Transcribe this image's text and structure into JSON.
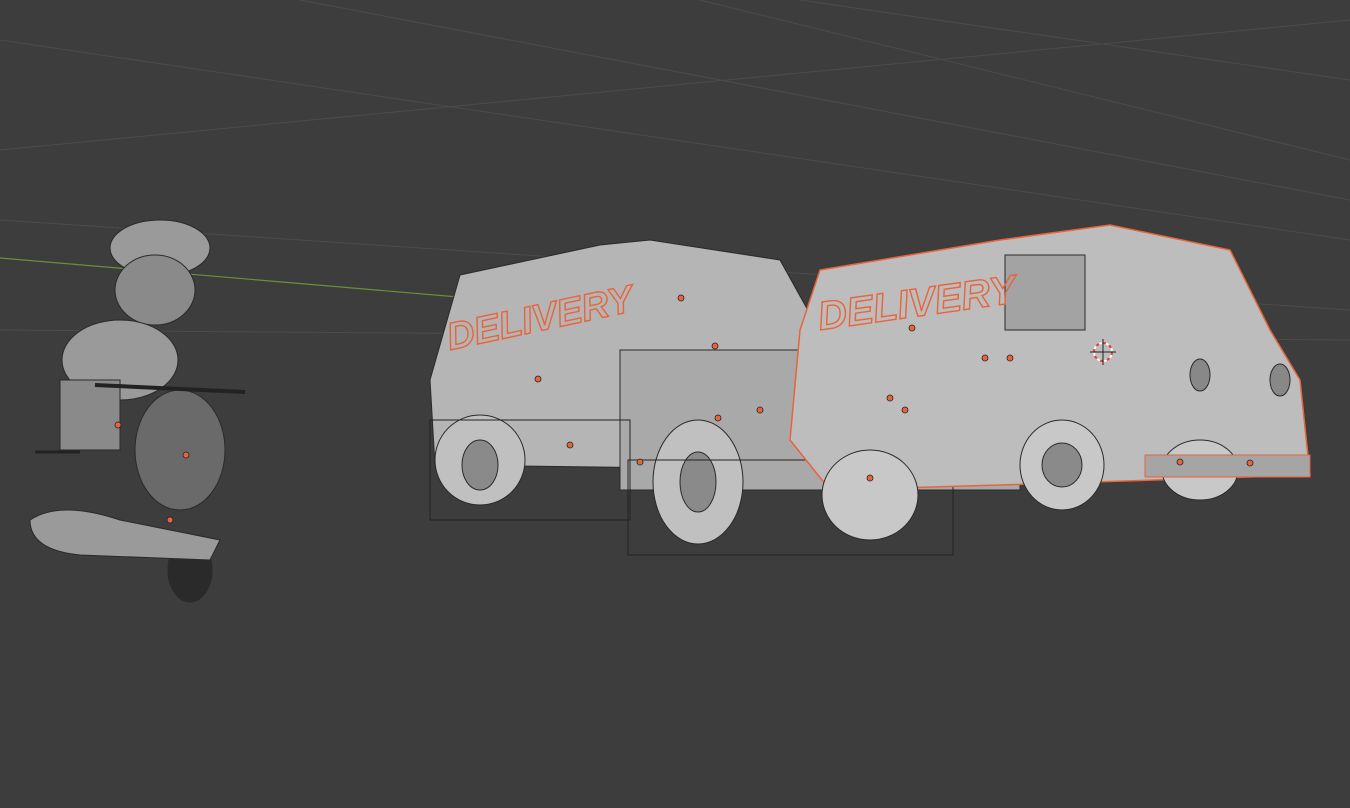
{
  "viewport": {
    "mode": "3D viewport - edit/wireframe overlay",
    "objects": [
      {
        "name": "scooter-rider"
      },
      {
        "name": "delivery-van-back",
        "decal": "DELIVERY"
      },
      {
        "name": "delivery-van-front",
        "decal": "DELIVERY",
        "selected": true
      }
    ]
  },
  "colors": {
    "background": "#3d3d3d",
    "grid": "#4a4a4a",
    "x_axis": "#6b8f3a",
    "mesh": "#b8b8b8",
    "selection": "#e8643a"
  }
}
